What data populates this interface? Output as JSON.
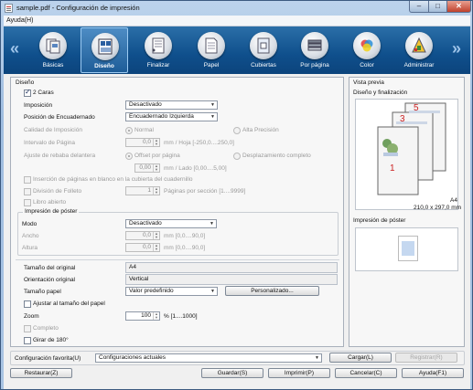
{
  "window": {
    "title": "sample.pdf - Configuración de impresión",
    "minimize": "–",
    "maximize": "□",
    "close": "✕"
  },
  "menu": {
    "help": "Ayuda(H)"
  },
  "toolbar": {
    "prev": "«",
    "next": "»",
    "tabs": [
      {
        "label": "Básicas",
        "icon": "basic-settings-icon"
      },
      {
        "label": "Diseño",
        "icon": "layout-icon",
        "active": true
      },
      {
        "label": "Finalizar",
        "icon": "finishing-icon"
      },
      {
        "label": "Papel",
        "icon": "paper-icon"
      },
      {
        "label": "Cubiertas",
        "icon": "cover-icon"
      },
      {
        "label": "Por página",
        "icon": "per-page-icon"
      },
      {
        "label": "Color",
        "icon": "color-icon"
      },
      {
        "label": "Administrar",
        "icon": "manage-icon"
      }
    ]
  },
  "design": {
    "section_title": "Diseño",
    "duplex": "2 Caras",
    "imposition_label": "Imposición",
    "imposition_value": "Desactivado",
    "binding_label": "Posición de Encuadernado",
    "binding_value": "Encuadernado Izquierda",
    "quality_label": "Calidad de Imposición",
    "quality_normal": "Normal",
    "quality_high": "Alta Precisión",
    "page_interval_label": "Intervalo de Página",
    "page_interval_value": "0,0",
    "page_interval_unit": "mm / Hoja [-250,0....250,0]",
    "front_adjust_label": "Ajuste de rebaba delantera",
    "offset_per_page": "Offset por página",
    "full_shift": "Desplazamiento completo",
    "front_adjust_value": "0,00",
    "front_adjust_unit": "mm / Lado [0,00....5,00]",
    "insert_blank": "Inserción de páginas en blanco en la cubierta del cuadernillo",
    "booklet_split": "División de Folleto",
    "booklet_split_value": "1",
    "booklet_split_unit": "Páginas por sección [1....9999]",
    "open_book": "Libro abierto"
  },
  "poster": {
    "group_title": "Impresión de póster",
    "mode_label": "Modo",
    "mode_value": "Desactivado",
    "width_label": "Ancho",
    "width_value": "0,0",
    "width_unit": "mm [0,0....90,0]",
    "height_label": "Altura",
    "height_value": "0,0",
    "height_unit": "mm [0,0....90,0]"
  },
  "paper": {
    "original_size_label": "Tamaño del original",
    "original_size_value": "A4",
    "orientation_label": "Orientación original",
    "orientation_value": "Vertical",
    "paper_size_label": "Tamaño papel",
    "paper_size_value": "Valor predefinido",
    "custom_button": "Personalizado...",
    "fit_paper": "Ajustar al tamaño del papel",
    "zoom_label": "Zoom",
    "zoom_value": "100",
    "zoom_unit": "% [1....1000]",
    "full": "Completo",
    "rotate": "Girar de 180°"
  },
  "preview": {
    "title": "Vista previa",
    "subtitle": "Diseño y finalización",
    "page_numbers": [
      "5",
      "3",
      "1"
    ],
    "paper_name": "A4",
    "paper_dims": "210,0 x 297,0 mm",
    "poster_title": "Impresión de póster"
  },
  "favorites": {
    "label": "Configuración favorita(U)",
    "value": "Configuraciones actuales",
    "load_button": "Cargar(L)",
    "register_button": "Registrar(R)"
  },
  "footer": {
    "restore": "Restaurar(Z)",
    "save": "Guardar(S)",
    "print": "Imprimir(P)",
    "cancel": "Cancelar(C)",
    "help": "Ayuda(F1)"
  },
  "colors": {
    "toolbar_bg": "#0f4f8c",
    "window_frame": "#9fbde0",
    "page_number_red": "#cc2222"
  }
}
